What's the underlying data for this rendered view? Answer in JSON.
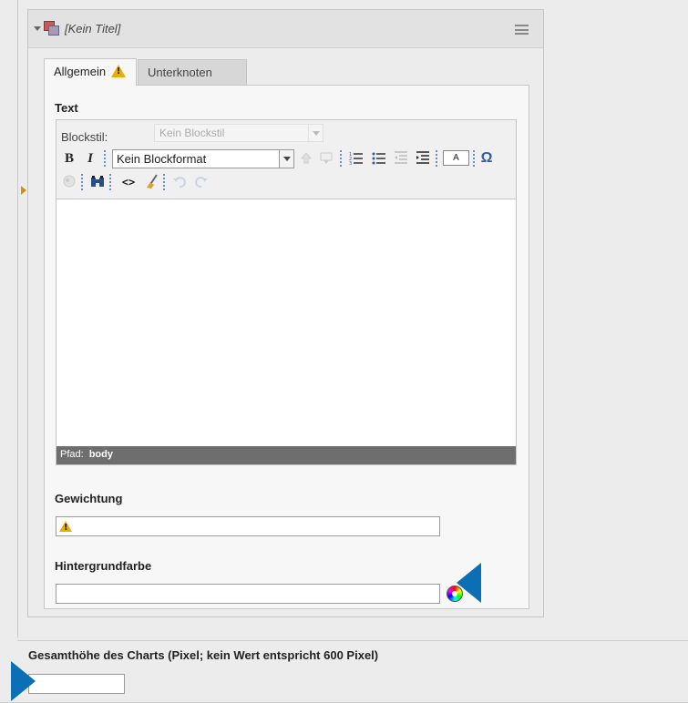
{
  "panel": {
    "title": "[Kein Titel]",
    "icons": {
      "toggle": "collapse-triangle-icon",
      "node": "content-node-icon",
      "menu": "hamburger-menu-icon"
    }
  },
  "tabs": [
    {
      "label": "Allgemein",
      "active": true,
      "warning": true
    },
    {
      "label": "Unterknoten",
      "active": false
    }
  ],
  "text_field": {
    "label": "Text",
    "blockstil_label": "Blockstil:",
    "blockstil_value": "Kein Blockstil",
    "blockformat_value": "Kein Blockformat",
    "toolbar": {
      "bold": "B",
      "italic": "I",
      "source": "<>",
      "font_color": "A",
      "special_char": "Ω"
    },
    "path_label": "Pfad:",
    "path_value": "body"
  },
  "gewichtung": {
    "label": "Gewichtung",
    "value": ""
  },
  "hintergrundfarbe": {
    "label": "Hintergrundfarbe",
    "value": ""
  },
  "chart_height": {
    "label": "Gesamthöhe des Charts (Pixel; kein Wert entspricht 600 Pixel)",
    "value": ""
  },
  "colors": {
    "accent_pointer": "#0a6fb5",
    "warning": "#e7b000",
    "path_bar": "#6e6e6e"
  }
}
